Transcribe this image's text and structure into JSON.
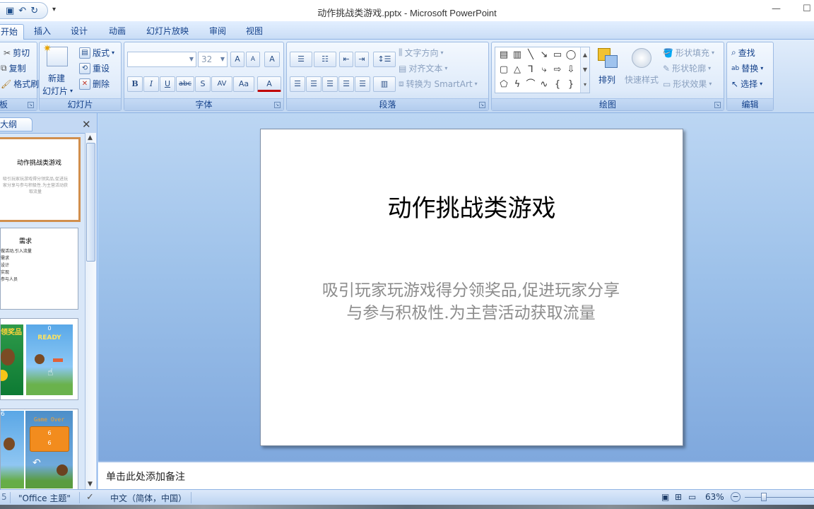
{
  "window": {
    "title": "动作挑战类游戏.pptx - Microsoft PowerPoint",
    "minimize": "—",
    "maximize": "☐"
  },
  "qat": {
    "save": "▣",
    "undo": "↶",
    "redo": "↻",
    "more": "▾"
  },
  "tabs": [
    "开始",
    "插入",
    "设计",
    "动画",
    "幻灯片放映",
    "审阅",
    "视图"
  ],
  "ribbon": {
    "clipboard": {
      "cut": "剪切",
      "copy": "复制",
      "format_painter": "格式刷",
      "label": "板"
    },
    "slides": {
      "new_slide": "新建",
      "new_slide_2": "幻灯片",
      "layout": "版式",
      "reset": "重设",
      "delete": "删除",
      "label": "幻灯片"
    },
    "font": {
      "size": "32",
      "grow": "A",
      "shrink": "A",
      "clear": "A",
      "bold": "B",
      "italic": "I",
      "underline": "U",
      "strike": "abc",
      "shadow": "S",
      "spacing": "AV",
      "case": "Aa",
      "color": "A",
      "label": "字体"
    },
    "paragraph": {
      "text_direction": "文字方向",
      "align_text": "对齐文本",
      "smartart": "转换为 SmartArt",
      "label": "段落"
    },
    "drawing": {
      "arrange": "排列",
      "quick_styles": "快速样式",
      "shape_fill": "形状填充",
      "shape_outline": "形状轮廓",
      "shape_effects": "形状效果",
      "label": "绘图"
    },
    "editing": {
      "find": "查找",
      "replace": "替换",
      "select": "选择",
      "label": "编辑"
    }
  },
  "pane": {
    "tab_label": "大纲",
    "close": "✕",
    "thumbs": [
      {
        "title": "动作挑战类游戏",
        "body": "吸引玩家玩游戏得分领奖品,促进玩家分享与参与积极性.为主营活动获取流量"
      },
      {
        "title": "需求",
        "lines": [
          "做活动,引入流量",
          "需求",
          "设计",
          "实现",
          "参与人员"
        ]
      },
      {
        "left_text": "领奖品",
        "right_top": "0",
        "right_mid": "READY"
      },
      {
        "left_text": "6",
        "right_top": "Game Over",
        "right_mid": "6",
        "right_bot": "6"
      }
    ]
  },
  "slide": {
    "title": "动作挑战类游戏",
    "subtitle": "吸引玩家玩游戏得分领奖品,促进玩家分享与参与积极性.为主营活动获取流量"
  },
  "notes": {
    "placeholder": "单击此处添加备注"
  },
  "status": {
    "slide_num": "5",
    "theme": "\"Office 主题\"",
    "language": "中文（简体，中国）",
    "zoom": "63%",
    "zoom_out": "−"
  }
}
